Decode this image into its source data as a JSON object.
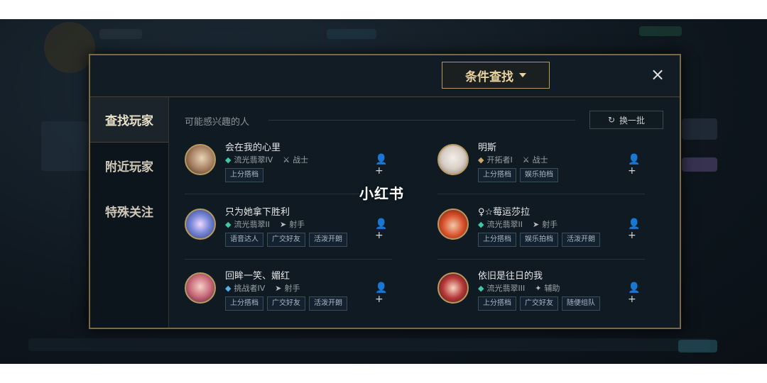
{
  "dialog": {
    "filter_label": "条件查找",
    "close_label": "×"
  },
  "sidebar": {
    "items": [
      {
        "label": "查找玩家"
      },
      {
        "label": "附近玩家"
      },
      {
        "label": "特殊关注"
      }
    ]
  },
  "main": {
    "section_title": "可能感兴趣的人",
    "refresh_label": "换一批",
    "players": [
      {
        "name": "会在我的心里",
        "rank": "流光翡翠IV",
        "role": "战士",
        "tags": [
          "上分搭档"
        ],
        "rank_icon": "emerald-rank-icon",
        "role_icon": "fighter-icon"
      },
      {
        "name": "明斯",
        "rank": "开拓者I",
        "role": "战士",
        "tags": [
          "上分搭档",
          "娱乐拍档"
        ],
        "rank_icon": "pioneer-rank-icon",
        "role_icon": "fighter-icon"
      },
      {
        "name": "只为她拿下胜利",
        "rank": "流光翡翠II",
        "role": "射手",
        "tags": [
          "语音达人",
          "广交好友",
          "活泼开朗"
        ],
        "rank_icon": "emerald-rank-icon",
        "role_icon": "marksman-icon"
      },
      {
        "name": "♀☆莓运莎拉",
        "rank": "流光翡翠II",
        "role": "射手",
        "tags": [
          "上分搭档",
          "娱乐拍档",
          "活泼开朗"
        ],
        "rank_icon": "emerald-rank-icon",
        "role_icon": "marksman-icon"
      },
      {
        "name": "回眸一笑、媚红",
        "rank": "挑战者IV",
        "role": "射手",
        "tags": [
          "上分搭档",
          "广交好友",
          "活泼开朗"
        ],
        "rank_icon": "challenger-rank-icon",
        "role_icon": "marksman-icon"
      },
      {
        "name": "依旧是往日的我",
        "rank": "流光翡翠III",
        "role": "辅助",
        "tags": [
          "上分搭档",
          "广交好友",
          "随便组队"
        ],
        "rank_icon": "emerald-rank-icon",
        "role_icon": "support-icon"
      }
    ]
  },
  "watermark": "小红书",
  "colors": {
    "accent_gold": "#b59a5c",
    "rank_teal": "#3cc9a6",
    "panel_bg": "#0f1a22"
  }
}
